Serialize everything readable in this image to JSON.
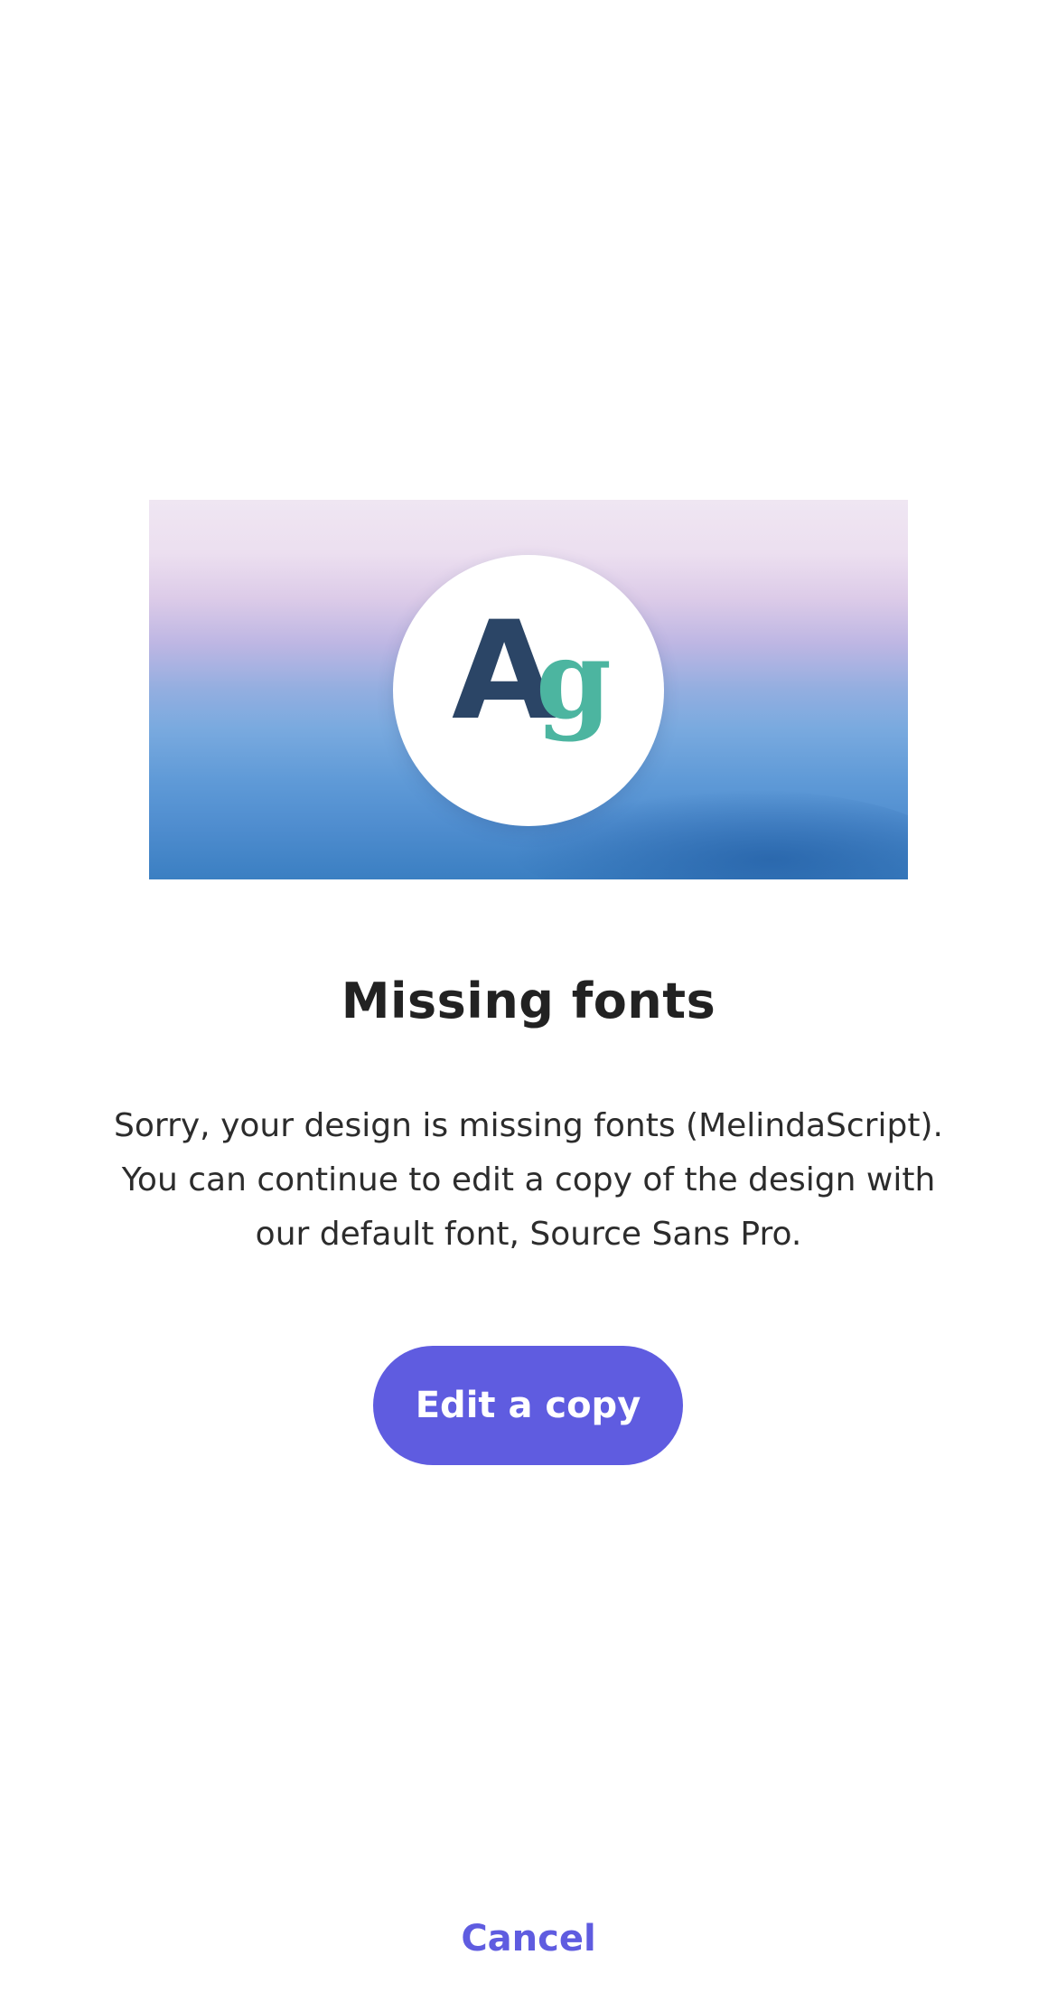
{
  "dialog": {
    "illustration": {
      "icon": "font-glyph-icon",
      "glyph_primary": "A",
      "glyph_secondary": "g",
      "colors": {
        "glyph_primary": "#2b4566",
        "glyph_secondary": "#4cb5a0"
      }
    },
    "title": "Missing fonts",
    "message": "Sorry, your design is missing fonts (MelindaScript). You can continue to edit a copy of the design with our default font, Source Sans Pro.",
    "primary_button_label": "Edit a copy",
    "cancel_label": "Cancel"
  },
  "colors": {
    "accent": "#5f5ce0",
    "background": "#ffffff",
    "text": "#222222"
  }
}
